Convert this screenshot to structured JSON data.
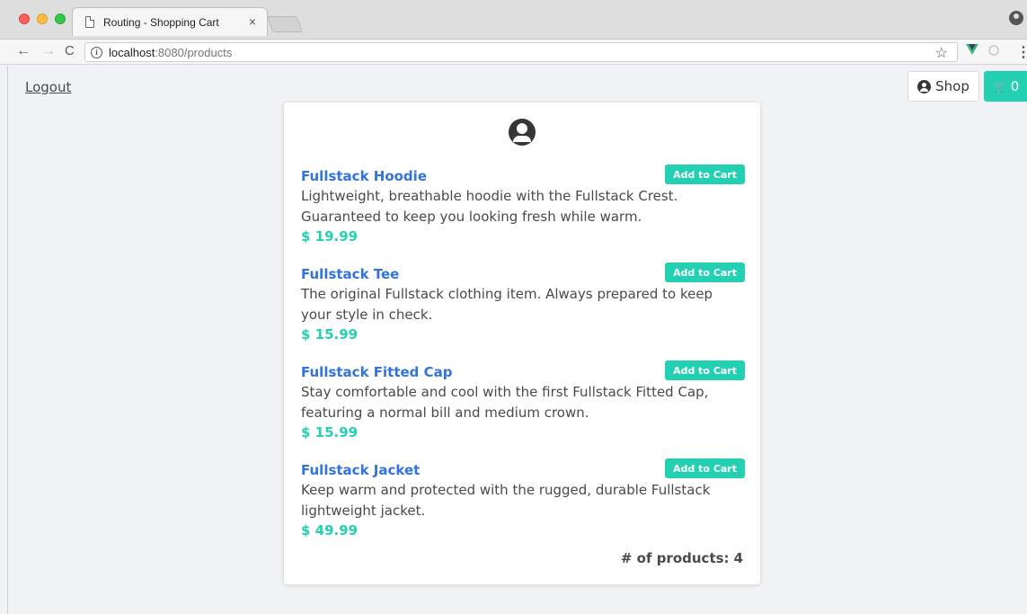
{
  "browser": {
    "tab_title": "Routing - Shopping Cart",
    "tab_close": "×",
    "url_host": "localhost",
    "url_rest": ":8080/products"
  },
  "header": {
    "logout_label": "Logout",
    "shop_label": "Shop",
    "cart_icon": "🛒",
    "cart_count": "0"
  },
  "products": [
    {
      "name": "Fullstack Hoodie",
      "description": "Lightweight, breathable hoodie with the Fullstack Crest. Guaranteed to keep you looking fresh while warm.",
      "price": "$ 19.99",
      "button_label": "Add to Cart"
    },
    {
      "name": "Fullstack Tee",
      "description": "The original Fullstack clothing item. Always prepared to keep your style in check.",
      "price": "$ 15.99",
      "button_label": "Add to Cart"
    },
    {
      "name": "Fullstack Fitted Cap",
      "description": "Stay comfortable and cool with the first Fullstack Fitted Cap, featuring a normal bill and medium crown.",
      "price": "$ 15.99",
      "button_label": "Add to Cart"
    },
    {
      "name": "Fullstack Jacket",
      "description": "Keep warm and protected with the rugged, durable Fullstack lightweight jacket.",
      "price": "$ 49.99",
      "button_label": "Add to Cart"
    }
  ],
  "footer": {
    "count_label": "# of products:",
    "count_value": "4"
  },
  "colors": {
    "accent": "#23d1b2",
    "link": "#3273dc",
    "text": "#4a4a4a"
  }
}
